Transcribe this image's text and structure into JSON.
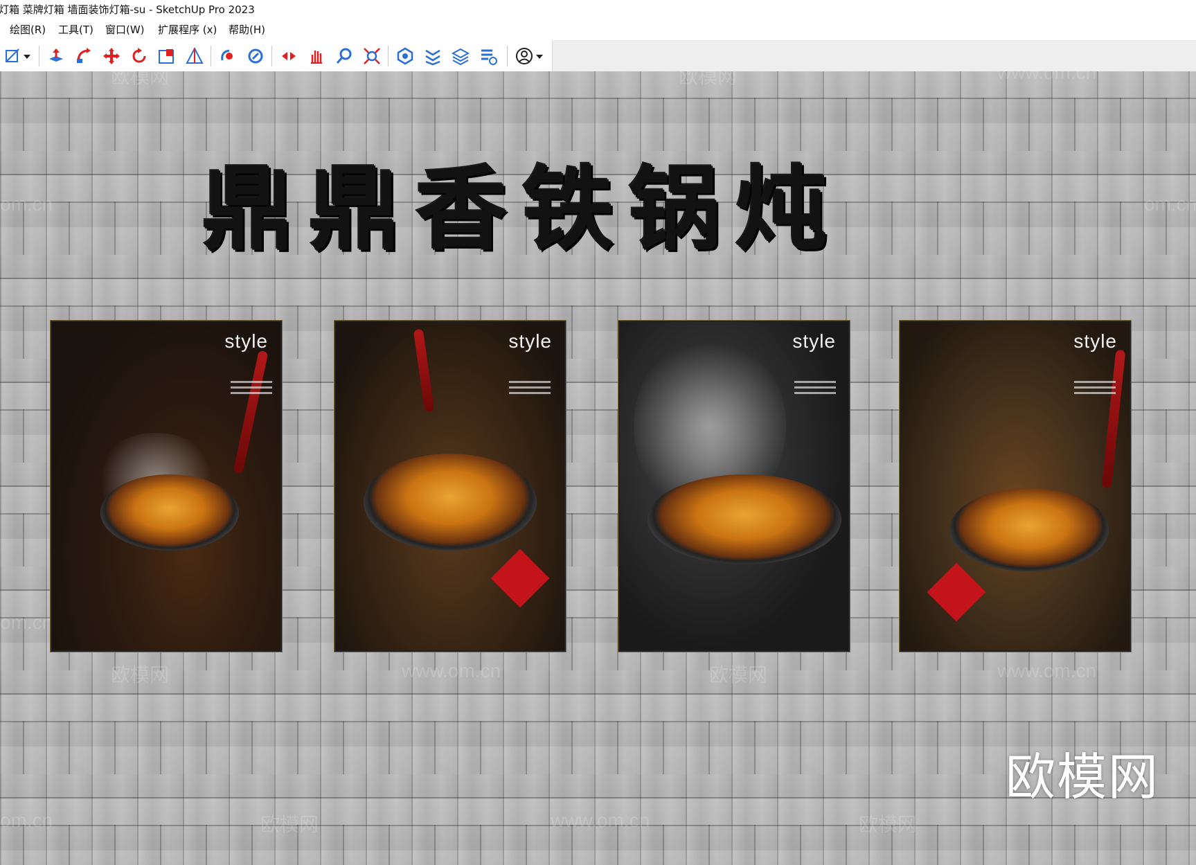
{
  "window": {
    "title": "灯箱 菜牌灯箱 墙面装饰灯箱-su - SketchUp Pro 2023"
  },
  "menu": [
    {
      "label": "绘图(R)"
    },
    {
      "label": "工具(T)"
    },
    {
      "label": "窗口(W)"
    },
    {
      "label": "扩展程序 (x)"
    },
    {
      "label": "帮助(H)"
    }
  ],
  "toolbar": {
    "tools": [
      "line-icon",
      "dropdown-arrow-icon",
      "push-pull-icon",
      "follow-me-icon",
      "move-icon",
      "rotate-icon",
      "scale-icon",
      "section-plane-icon",
      "orbit-icon",
      "pan-icon",
      "walk-icon",
      "hand-icon",
      "zoom-icon",
      "zoom-extents-icon",
      "warehouse-icon",
      "extension-warehouse-icon",
      "layout-icon",
      "style-builder-icon",
      "account-icon",
      "account-dropdown-icon"
    ]
  },
  "scene": {
    "headline": "鼎鼎香铁锅炖",
    "posters": [
      {
        "label": "style"
      },
      {
        "label": "style"
      },
      {
        "label": "style"
      },
      {
        "label": "style"
      }
    ],
    "brand": "欧模网",
    "watermarks": {
      "logo": "欧模网",
      "url": "www.om.cn",
      "url_partial": "om.cn"
    }
  },
  "colors": {
    "wall": "#bdbdbd",
    "headline": "#121212",
    "brand": "#ffffff",
    "toolbar_bg": "#ffffff"
  }
}
